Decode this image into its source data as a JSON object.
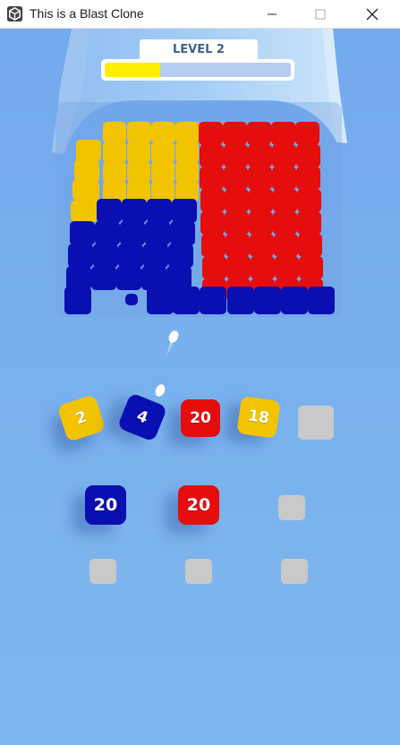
{
  "window": {
    "title": "This is a Blast Clone"
  },
  "level": {
    "label": "LEVEL 2",
    "progress": 0.3
  },
  "colors": {
    "yellow": "#f2c400",
    "blue": "#0a0fb2",
    "red": "#e60d0d",
    "background": "#7ab2ee",
    "slot": "#c9c9c9"
  },
  "shooter_row1": [
    {
      "count": "2",
      "color": "yellow"
    },
    {
      "count": "4",
      "color": "blue"
    },
    {
      "count": "20",
      "color": "red"
    },
    {
      "count": "18",
      "color": "yellow"
    }
  ],
  "shooter_row2": [
    {
      "count": "20",
      "color": "blue"
    },
    {
      "count": "20",
      "color": "red"
    }
  ]
}
